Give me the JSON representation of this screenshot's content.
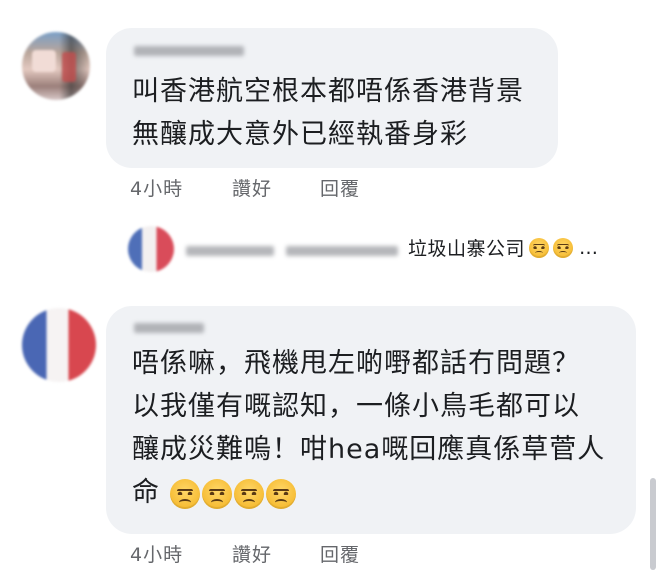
{
  "comments": [
    {
      "text_lines": [
        "叫香港航空根本都唔係香港背景",
        "無釀成大意外已經執番身彩"
      ],
      "actions": {
        "time": "4小時",
        "like": "讚好",
        "reply": "回覆"
      }
    },
    {
      "text_lines": [
        "唔係嘛，飛機甩左啲嘢都話冇問題？",
        "以我僅有嘅認知，一條小鳥毛都可以",
        "釀成災難嗚！咁hea嘅回應真係草菅人",
        "命"
      ],
      "emoji": [
        "angry-face-icon",
        "angry-face-icon",
        "angry-face-icon",
        "angry-face-icon"
      ],
      "actions": {
        "time": "4小時",
        "like": "讚好",
        "reply": "回覆"
      }
    }
  ],
  "reply_preview": {
    "text": "垃圾山寨公司",
    "emoji": [
      "angry-face-icon",
      "angry-face-icon"
    ],
    "ellipsis": "…"
  }
}
